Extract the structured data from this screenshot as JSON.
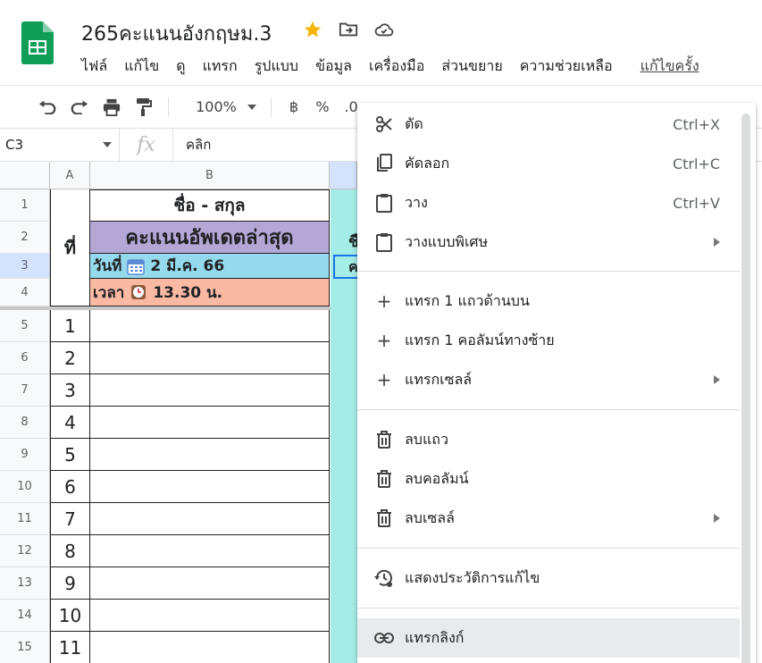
{
  "document": {
    "title": "265คะแนนอังกฤษม.3",
    "star_color": "#f4b400"
  },
  "menu": [
    "ไฟล์",
    "แก้ไข",
    "ดู",
    "แทรก",
    "รูปแบบ",
    "ข้อมูล",
    "เครื่องมือ",
    "ส่วนขยาย",
    "ความช่วยเหลือ"
  ],
  "menu_last_edit": "แก้ไขครั้ง",
  "toolbar": {
    "zoom": "100%",
    "currency": "฿",
    "percent": "%",
    "decimal": ".0"
  },
  "formula_bar": {
    "cell_ref": "C3",
    "fx": "fx",
    "value": "คลิก"
  },
  "grid": {
    "col_headers": [
      "A",
      "B"
    ],
    "row_numbers": [
      "1",
      "2",
      "3",
      "4",
      "5",
      "6",
      "7",
      "8",
      "9",
      "10",
      "11",
      "12",
      "13",
      "14",
      "15"
    ],
    "b1": "ชื่อ - สกุล",
    "b2": "คะแนนอัพเดตล่าสุด",
    "b3_label": "วันที่",
    "b3_value": "2 มี.ค. 66",
    "b4_label": "เวลา",
    "b4_value": "13.30 น.",
    "a_header": "ที่",
    "c2_partial": "ชื",
    "c3_partial": "ค",
    "numbers": [
      "1",
      "2",
      "3",
      "4",
      "5",
      "6",
      "7",
      "8",
      "9",
      "10",
      "11"
    ]
  },
  "context_menu": {
    "cut": {
      "label": "ตัด",
      "shortcut": "Ctrl+X"
    },
    "copy": {
      "label": "คัดลอก",
      "shortcut": "Ctrl+C"
    },
    "paste": {
      "label": "วาง",
      "shortcut": "Ctrl+V"
    },
    "paste_special": {
      "label": "วางแบบพิเศษ"
    },
    "insert_row_above": {
      "label": "แทรก 1 แถวด้านบน"
    },
    "insert_col_left": {
      "label": "แทรก 1 คอลัมน์ทางซ้าย"
    },
    "insert_cells": {
      "label": "แทรกเซลล์"
    },
    "delete_row": {
      "label": "ลบแถว"
    },
    "delete_col": {
      "label": "ลบคอลัมน์"
    },
    "delete_cells": {
      "label": "ลบเซลล์"
    },
    "show_history": {
      "label": "แสดงประวัติการแก้ไข"
    },
    "insert_link": {
      "label": "แทรกลิงก์"
    }
  },
  "colors": {
    "purple_header": "#b4a7d6",
    "date_cell": "#94d9ec",
    "time_cell": "#f9b9a3",
    "col_c": "#a3ede6",
    "sheets_green": "#0f9d58"
  }
}
